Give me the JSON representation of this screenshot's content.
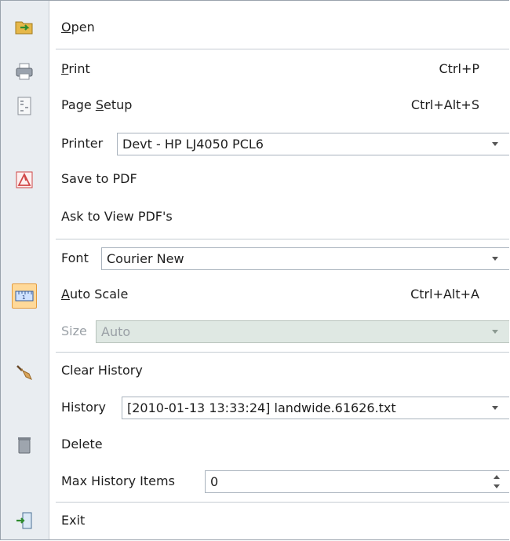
{
  "menu": {
    "open": {
      "pre": "",
      "u": "O",
      "post": "pen"
    },
    "print": {
      "pre": "",
      "u": "P",
      "post": "rint",
      "shortcut": "Ctrl+P"
    },
    "page_setup": {
      "pre": "Page ",
      "u": "S",
      "post": "etup",
      "shortcut": "Ctrl+Alt+S"
    },
    "printer": {
      "label": "Printer",
      "value": "Devt - HP LJ4050 PCL6"
    },
    "save_pdf": {
      "label": "Save to PDF"
    },
    "ask_pdf": {
      "label": "Ask to View PDF's"
    },
    "font": {
      "label": "Font",
      "value": "Courier New"
    },
    "auto_scale": {
      "pre": "",
      "u": "A",
      "post": "uto Scale",
      "shortcut": "Ctrl+Alt+A"
    },
    "size": {
      "label": "Size",
      "value": "Auto"
    },
    "clear_history": {
      "label": "Clear History"
    },
    "history": {
      "label": "History",
      "value": "[2010-01-13 13:33:24] landwide.61626.txt"
    },
    "delete": {
      "label": "Delete"
    },
    "max_history": {
      "label": "Max History Items",
      "value": "0"
    },
    "exit": {
      "label": "Exit"
    }
  },
  "icons": {
    "open": "folder-open-icon",
    "print": "printer-icon",
    "page_setup": "page-setup-icon",
    "save_pdf": "pdf-icon",
    "auto_scale": "ruler-icon",
    "clear_history": "broom-icon",
    "delete": "trash-icon",
    "exit": "exit-door-icon"
  },
  "colors": {
    "gutter": "#e9edf1",
    "highlight": "#ffd999",
    "disabled_field": "#dfe8e3"
  }
}
